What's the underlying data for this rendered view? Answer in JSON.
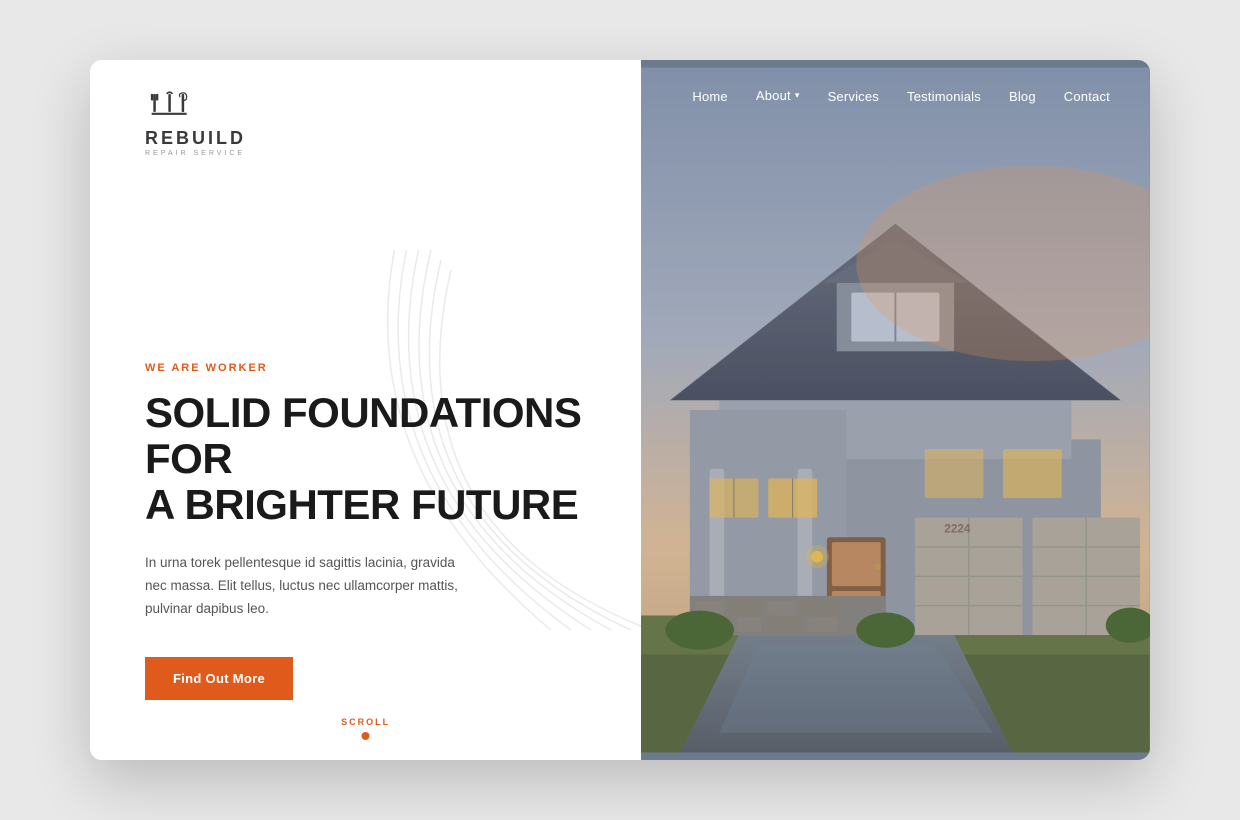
{
  "logo": {
    "brand": "REBUILD",
    "subtitle": "REPAIR SERVICE"
  },
  "nav": {
    "items": [
      {
        "label": "Home",
        "has_dropdown": false
      },
      {
        "label": "About",
        "has_dropdown": true
      },
      {
        "label": "Services",
        "has_dropdown": false
      },
      {
        "label": "Testimonials",
        "has_dropdown": false
      },
      {
        "label": "Blog",
        "has_dropdown": false
      },
      {
        "label": "Contact",
        "has_dropdown": false
      }
    ]
  },
  "hero": {
    "tagline": "WE ARE WORKER",
    "title_line1": "SOLID FOUNDATIONS FOR",
    "title_line2": "A BRIGHTER FUTURE",
    "description": "In urna torek pellentesque id sagittis lacinia, gravida nec massa. Elit tellus, luctus nec ullamcorper mattis, pulvinar dapibus leo.",
    "cta_label": "Find Out More"
  },
  "scroll": {
    "label": "SCROLL"
  },
  "colors": {
    "accent": "#e05a1c",
    "nav_text": "#ffffff",
    "hero_title": "#1a1a1a",
    "tagline": "#e05a1c"
  }
}
